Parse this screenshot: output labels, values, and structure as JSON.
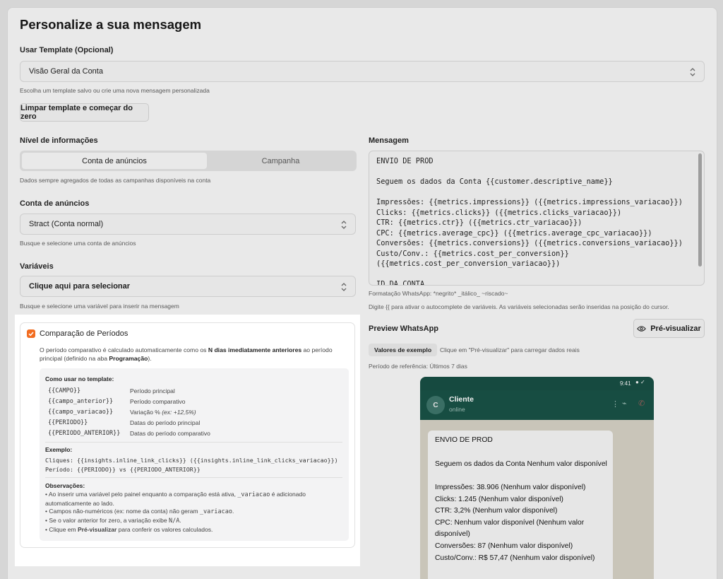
{
  "page_title": "Personalize a sua mensagem",
  "template": {
    "label": "Usar Template (Opcional)",
    "value": "Visão Geral da Conta",
    "help": "Escolha um template salvo ou crie uma nova mensagem personalizada",
    "clear_button": "Limpar template e começar do zero"
  },
  "nivel": {
    "label": "Nível de informações",
    "options": [
      "Conta de anúncios",
      "Campanha"
    ],
    "selected": "Conta de anúncios",
    "help": "Dados sempre agregados de todas as campanhas disponíveis na conta"
  },
  "conta": {
    "label": "Conta de anúncios",
    "value": "Stract (Conta normal)",
    "help": "Busque e selecione uma conta de anúncios"
  },
  "variaveis": {
    "label": "Variáveis",
    "value": "Clique aqui para selecionar",
    "help": "Busque e selecione uma variável para inserir na mensagem"
  },
  "comparacao": {
    "checked": true,
    "title": "Comparação de Períodos",
    "desc_1": "O período comparativo é calculado automaticamente como os ",
    "desc_bold": "N dias imediatamente anteriores",
    "desc_2": " ao período principal (definido na aba ",
    "desc_bold2": "Programação",
    "desc_3": ").",
    "howto_title": "Como usar no template:",
    "tokens": [
      {
        "token": "{{CAMPO}}",
        "desc": "Período principal"
      },
      {
        "token": "{{campo_anterior}}",
        "desc": "Período comparativo"
      },
      {
        "token": "{{campo_variacao}}",
        "desc": "Variação % ",
        "desc_em": "(ex: +12,5%)"
      },
      {
        "token": "{{PERIODO}}",
        "desc": "Datas do período principal"
      },
      {
        "token": "{{PERIODO_ANTERIOR}}",
        "desc": "Datas do período comparativo"
      }
    ],
    "example_title": "Exemplo:",
    "example_lines": [
      "Cliques: {{insights.inline_link_clicks}} ({{insights.inline_link_clicks_variacao}})",
      "Período: {{PERIODO}} vs {{PERIODO_ANTERIOR}}"
    ],
    "obs_title": "Observações:",
    "obs": {
      "o1a": "• Ao inserir uma variável pelo painel enquanto a comparação está ativa, ",
      "o1code": "_variacao",
      "o1b": " é adicionado automaticamente ao lado.",
      "o2a": "• Campos não-numéricos (ex: nome da conta) não geram ",
      "o2code": "_variacao",
      "o2b": ".",
      "o3a": "• Se o valor anterior for zero, a variação exibe ",
      "o3code": "N/A",
      "o3b": ".",
      "o4a": "• Clique em ",
      "o4bold": "Pré-visualizar",
      "o4b": " para conferir os valores calculados."
    }
  },
  "mensagem": {
    "label": "Mensagem",
    "lines": [
      "ENVIO DE PROD",
      "",
      "Seguem os dados da Conta {{customer.descriptive_name}}",
      "",
      "Impressões: {{metrics.impressions}} ({{metrics.impressions_variacao}})",
      "Clicks: {{metrics.clicks}} ({{metrics.clicks_variacao}})",
      "CTR: {{metrics.ctr}} ({{metrics.ctr_variacao}})",
      "CPC: {{metrics.average_cpc}} ({{metrics.average_cpc_variacao}})",
      "Conversões: {{metrics.conversions}} ({{metrics.conversions_variacao}})",
      "Custo/Conv.: {{metrics.cost_per_conversion}}",
      "({{metrics.cost_per_conversion_variacao}})",
      "",
      "ID DA CONTA"
    ],
    "format_help": "Formatação WhatsApp: *negrito* _itálico_ ~riscado~",
    "autocomplete_help": "Digite {{ para ativar o autocomplete de variáveis. As variáveis selecionadas serão inseridas na posição do cursor."
  },
  "preview": {
    "label": "Preview WhatsApp",
    "button": "Pré-visualizar",
    "chip": "Valores de exemplo",
    "chip_help": "Clique em \"Pré-visualizar\" para carregar dados reais",
    "periodo": "Período de referência: Últimos 7 dias",
    "time": "9:41",
    "contact_initial": "C",
    "contact_name": "Cliente",
    "contact_status": "online",
    "bubble_lines": [
      "ENVIO DE PROD",
      "",
      "Seguem os dados da Conta Nenhum valor disponível",
      "",
      "Impressões: 38.906 (Nenhum valor disponível)",
      "Clicks: 1.245 (Nenhum valor disponível)",
      "CTR: 3,2% (Nenhum valor disponível)",
      "CPC: Nenhum valor disponível (Nenhum valor",
      "disponível)",
      "Conversões: 87 (Nenhum valor disponível)",
      "Custo/Conv.: R$ 57,47 (Nenhum valor disponível)"
    ]
  },
  "colors": {
    "accent": "#f26d21",
    "whatsapp_header": "#174d42",
    "whatsapp_bg": "#c9c5b9"
  }
}
